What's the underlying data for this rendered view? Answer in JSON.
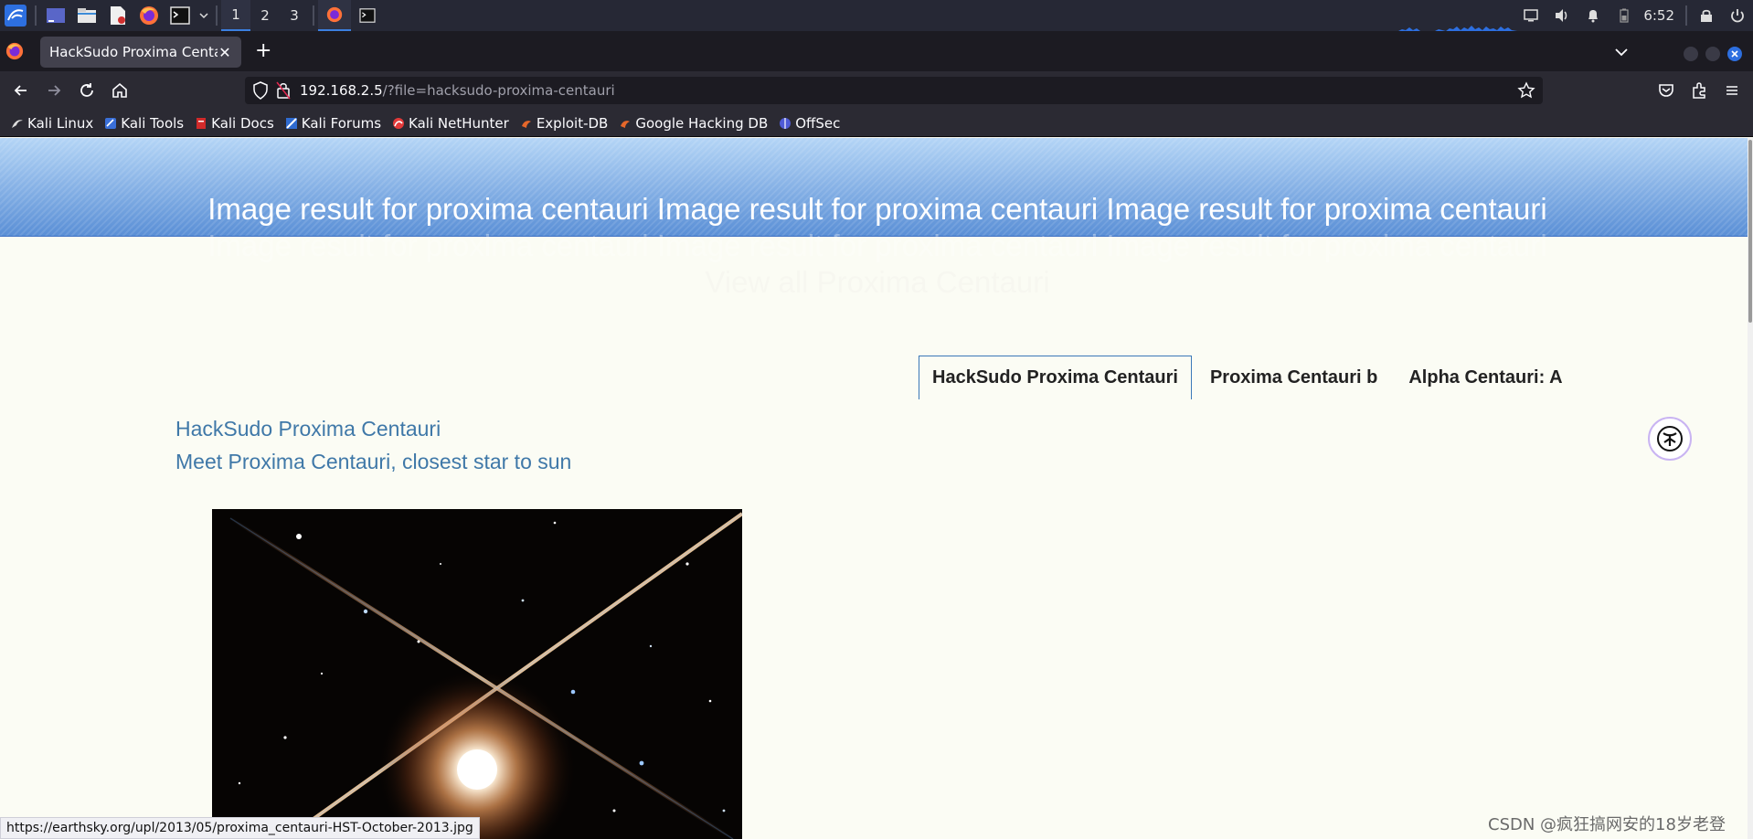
{
  "panel": {
    "workspaces": [
      "1",
      "2",
      "3"
    ],
    "clock": "6:52"
  },
  "browser": {
    "tab_title": "HackSudo Proxima Centauri",
    "url_host": "192.168.2.5",
    "url_path": "/?file=hacksudo-proxima-centauri",
    "bookmarks": [
      "Kali Linux",
      "Kali Tools",
      "Kali Docs",
      "Kali Forums",
      "Kali NetHunter",
      "Exploit-DB",
      "Google Hacking DB",
      "OffSec"
    ],
    "status_link": "https://earthsky.org/upl/2013/05/proxima_centauri-HST-October-2013.jpg"
  },
  "page": {
    "hero_line1": "Image result for proxima centauri Image result for proxima centauri Image result for proxima centauri",
    "hero_line2": "Image result for proxima centauri Image result for proxima centauri Image result for proxima centauri",
    "hero_line3": "View all Proxima Centauri",
    "tabs": [
      "HackSudo Proxima Centauri",
      "Proxima Centauri b",
      "Alpha Centauri: A"
    ],
    "links": [
      "HackSudo Proxima Centauri",
      "Meet Proxima Centauri, closest star to sun"
    ]
  },
  "watermark": "CSDN @疯狂搞网安的18岁老登",
  "colors": {
    "accent": "#3b7fe0",
    "banner_top": "#b4d5f6",
    "banner_bottom": "#5a8fd6",
    "link": "#3f78a8",
    "page_bg": "#fbfcf4"
  }
}
